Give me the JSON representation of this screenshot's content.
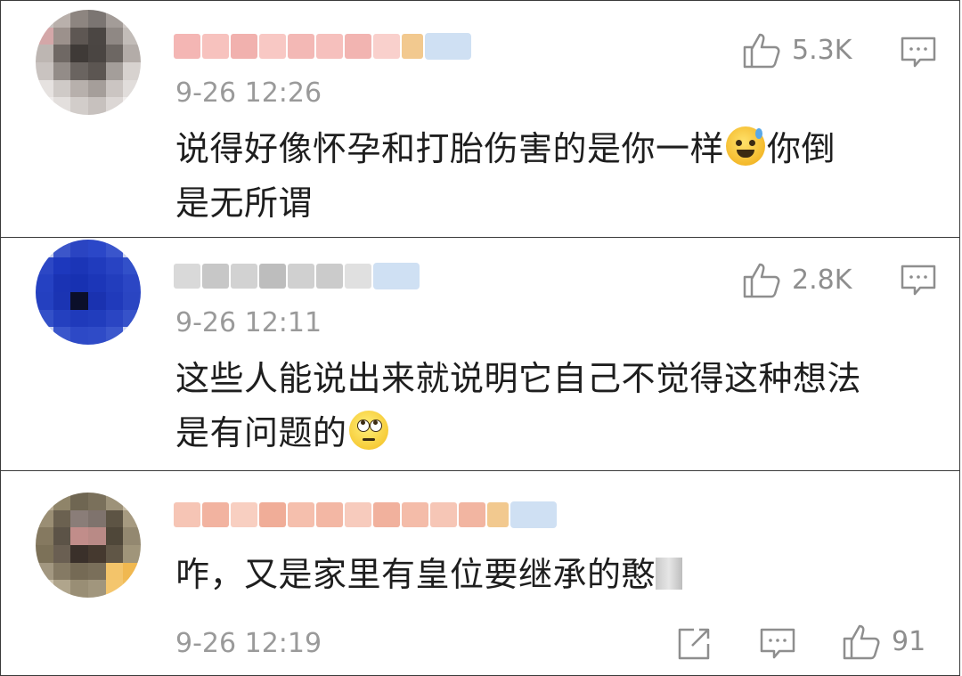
{
  "comments": [
    {
      "timestamp": "9-26 12:26",
      "text_before_emoji": "说得好像怀孕和打胎伤害的是你一样",
      "text_after_emoji": "你倒",
      "text_line2": "是无所谓",
      "emoji": "sweat-smile-emoji",
      "likes": "5.3K"
    },
    {
      "timestamp": "9-26 12:11",
      "text_line1": "这些人能说出来就说明它自己不觉得这种想法",
      "text_line2": "是有问题的",
      "emoji": "eye-roll-emoji",
      "likes": "2.8K"
    },
    {
      "timestamp": "9-26 12:19",
      "text": "咋，又是家里有皇位要继承的憨",
      "likes": "91"
    }
  ],
  "colors": {
    "border": "#3a3a3a",
    "timestamp": "#9a9a9a",
    "icon": "#8e8e8e",
    "text": "#1e1e1e"
  },
  "icons": [
    "thumbs-up-icon",
    "comment-icon",
    "share-icon"
  ]
}
